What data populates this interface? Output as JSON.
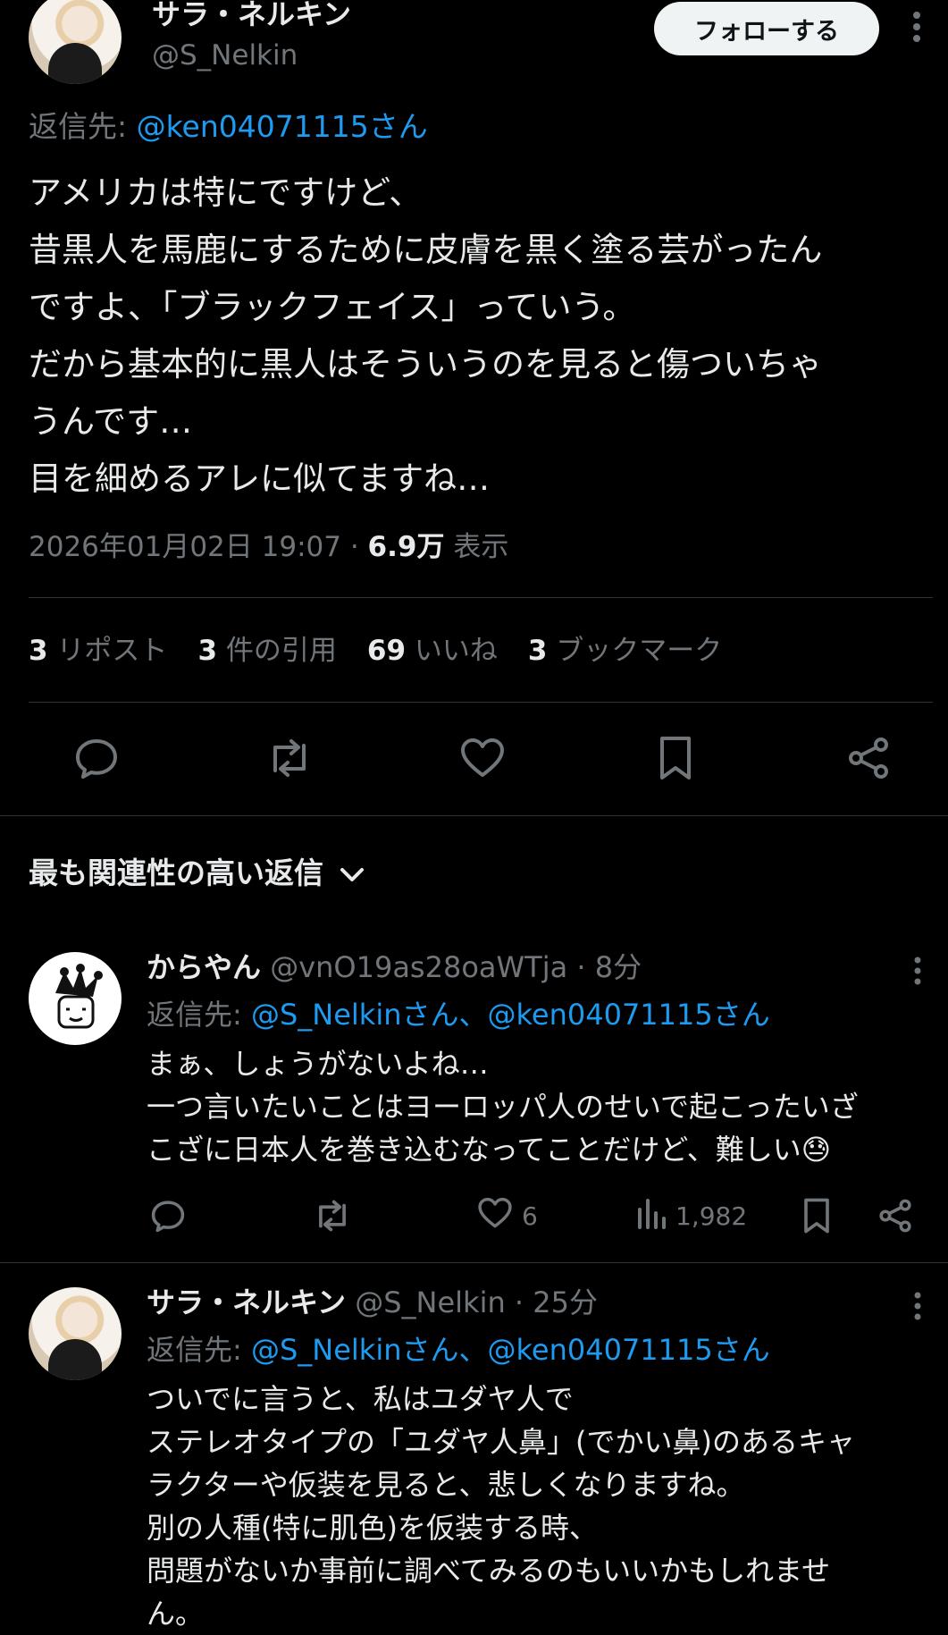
{
  "author": {
    "display_name": "サラ・ネルキン",
    "handle": "@S_Nelkin",
    "follow_label": "フォローする"
  },
  "main_post": {
    "reply_to_label": "返信先:",
    "reply_to_handle": "@ken04071115さん",
    "lines": [
      "アメリカは特にですけど、",
      "昔黒人を馬鹿にするために皮膚を黒く塗る芸がったん",
      "ですよ、「ブラックフェイス」っていう。",
      "だから基本的に黒人はそういうのを見ると傷ついちゃ",
      "うんです…",
      "目を細めるアレに似てますね…"
    ],
    "timestamp": "2026年01月02日 19:07 · ",
    "views_count": "6.9万",
    "views_label": " 表示",
    "stats": {
      "reposts_count": "3",
      "reposts_label": "リポスト",
      "quotes_count": "3",
      "quotes_label": "件の引用",
      "likes_count": "69",
      "likes_label": "いいね",
      "bookmarks_count": "3",
      "bookmarks_label": "ブックマーク"
    }
  },
  "replies_header": {
    "label": "最も関連性の高い返信"
  },
  "replies": [
    {
      "display_name": "からやん",
      "handle": "@vnO19as28oaWTja",
      "time": " · 8分",
      "reply_to_label": "返信先:",
      "reply_to_handles": "@S_Nelkinさん、@ken04071115さん",
      "lines": [
        "まぁ、しょうがないよね…",
        "一つ言いたいことはヨーロッパ人のせいで起こったいざ",
        "こざに日本人を巻き込むなってことだけど、難しい😓"
      ],
      "likes": "6",
      "views": "1,982"
    },
    {
      "display_name": "サラ・ネルキン",
      "handle": "@S_Nelkin",
      "time": " · 25分",
      "reply_to_label": "返信先:",
      "reply_to_handles": "@S_Nelkinさん、@ken04071115さん",
      "lines": [
        "ついでに言うと、私はユダヤ人で",
        "ステレオタイプの「ユダヤ人鼻」(でかい鼻)のあるキャ",
        "ラクターや仮装を見ると、悲しくなりますね。",
        "別の人種(特に肌色)を仮装する時、",
        "問題がないか事前に調べてみるのもいいかもしれませ",
        "ん。"
      ]
    }
  ],
  "colors": {
    "accent": "#1d9bf0",
    "muted": "#71767b",
    "text": "#e7e9ea",
    "background": "#000000",
    "divider": "#2f3336"
  },
  "icons": [
    "more-icon",
    "reply-icon",
    "repost-icon",
    "like-icon",
    "bookmark-icon",
    "share-icon",
    "chevron-down-icon",
    "views-icon"
  ]
}
